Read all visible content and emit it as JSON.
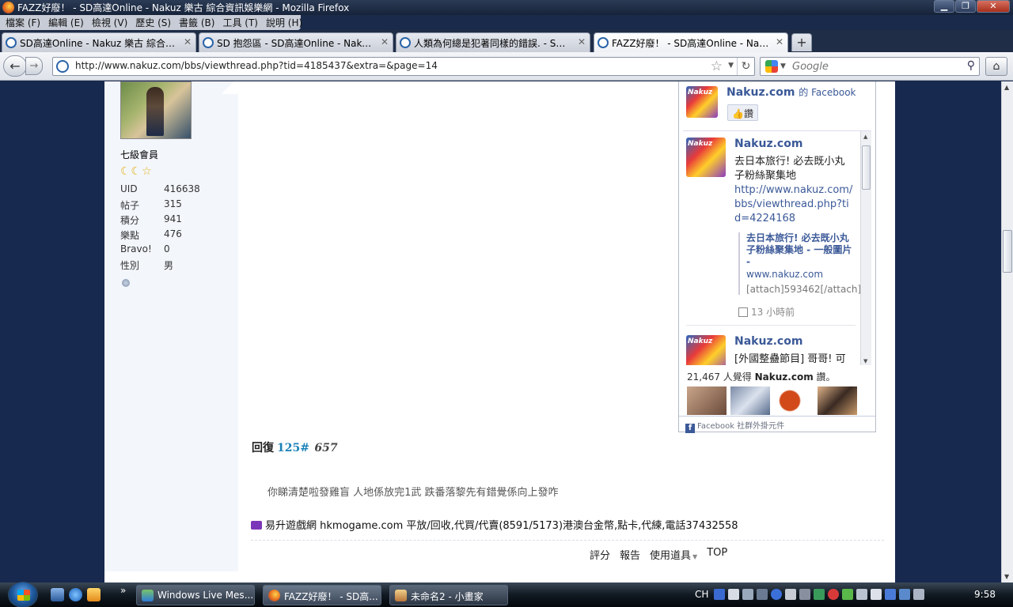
{
  "window": {
    "title": "FAZZ好廢！ - SD高達Online - Nakuz 樂古 綜合資訊娛樂網 - Mozilla Firefox"
  },
  "menubar": [
    "檔案 (F)",
    "編輯 (E)",
    "檢視 (V)",
    "歷史 (S)",
    "書籤 (B)",
    "工具 (T)",
    "說明 (H)"
  ],
  "tabs": [
    {
      "label": "SD高達Online - Nakuz 樂古 綜合資..."
    },
    {
      "label": "SD 抱怨區 - SD高達Online - Nakuz ..."
    },
    {
      "label": "人類為何總是犯著同樣的錯誤. - SD ..."
    },
    {
      "label": "FAZZ好廢！ - SD高達Online - Naku..."
    }
  ],
  "nav": {
    "url": "http://www.nakuz.com/bbs/viewthread.php?tid=4185437&extra=&page=14",
    "search_placeholder": "Google"
  },
  "profile": {
    "rank": "七級會員",
    "stars": "☾☾☆",
    "stats": [
      {
        "label": "UID",
        "value": "416638"
      },
      {
        "label": "帖子",
        "value": "315"
      },
      {
        "label": "積分",
        "value": "941"
      },
      {
        "label": "樂點",
        "value": "476"
      },
      {
        "label": "Bravo!",
        "value": "0"
      },
      {
        "label": "性別",
        "value": "男"
      }
    ]
  },
  "facebook": {
    "page_name": "Nakuz.com",
    "page_suffix": "的 Facebook",
    "logo_text": "Nakuz",
    "like_label": "讚",
    "stories": [
      {
        "name": "Nakuz.com",
        "text": "去日本旅行! 必去既小丸子粉絲聚集地",
        "link": "http://www.nakuz.com/bbs/viewthread.php?tid=4224168",
        "att_title": "去日本旅行! 必去既小丸子粉絲聚集地 - 一般圖片 -",
        "att_domain": "www.nakuz.com",
        "att_desc": "[attach]593462[/attach]",
        "time": "13 小時前"
      },
      {
        "name": "Nakuz.com",
        "text": "[外國整蠱節目] 哥哥! 可"
      }
    ],
    "count_num": "21,467 人覺得",
    "count_page": "Nakuz.com",
    "count_suffix": "讚。",
    "footer": "Facebook 社群外掛元件"
  },
  "post": {
    "reply_label": "回復",
    "floor": "125#",
    "reply_to": "657",
    "text": "你睇清楚啦發雞盲 人地係放完1武 跌番落黎先有錯覺係向上發咋",
    "ad": "易升遊戲網 hkmogame.com 平放/回收,代買/代賣(8591/5173)港澳台金幣,點卡,代練,電話37432558",
    "actions": [
      "評分",
      "報告",
      "使用道具",
      "TOP"
    ]
  },
  "taskbar": {
    "tasks": [
      "Windows Live Mes...",
      "FAZZ好廢！ - SD高...",
      "未命名2 - 小畫家"
    ],
    "lang": "CH",
    "clock": "9:58"
  },
  "colors": {
    "facebook_blue": "#3b5998",
    "floor_blue": "#1a82b8",
    "page_bg": "#17294f"
  }
}
